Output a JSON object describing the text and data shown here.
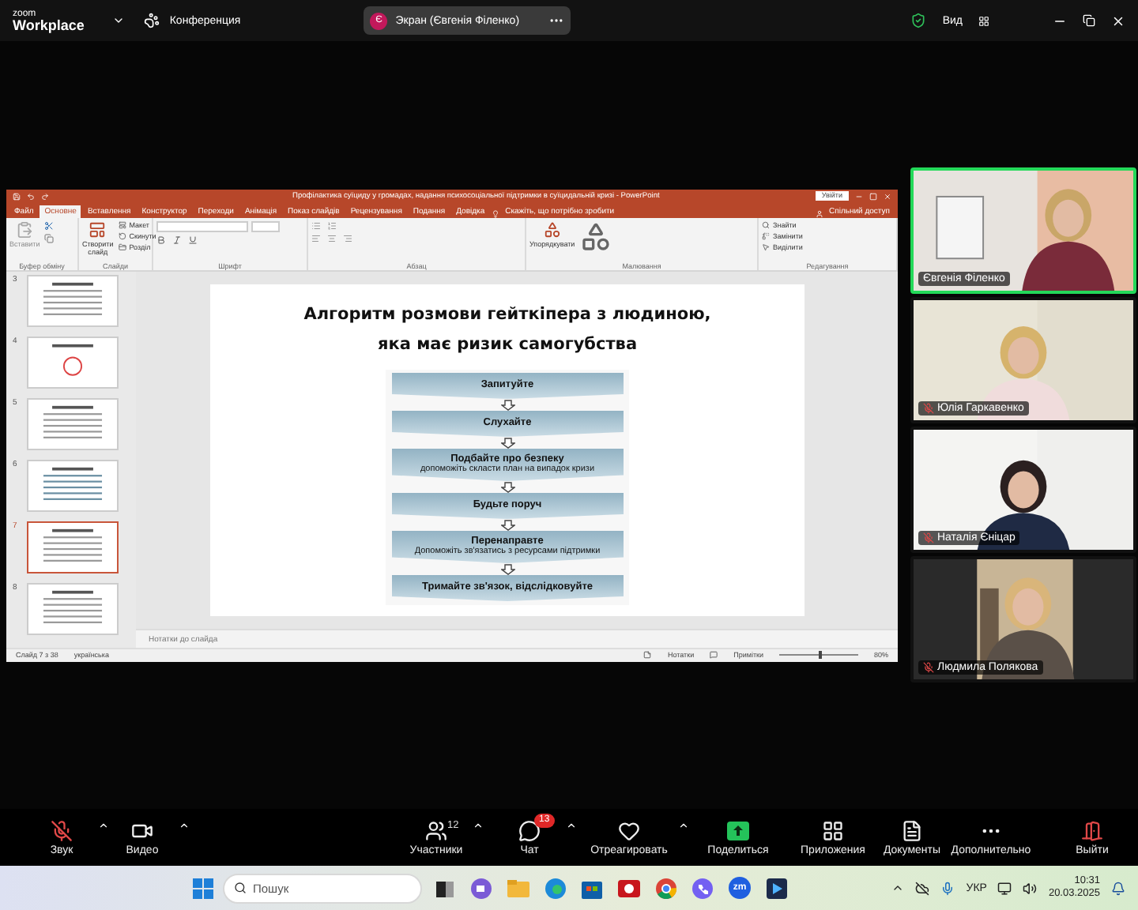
{
  "zoom_bar": {
    "logo_top": "zoom",
    "logo_bottom": "Workplace",
    "meeting_label": "Конференция",
    "screen_share": {
      "avatar": "Є",
      "title": "Экран (Євгенія Філенко)"
    },
    "view_label": "Вид"
  },
  "powerpoint": {
    "title": "Профілактика суїциду у громадах, надання психосоціальної підтримки в суїцидальній кризі  -  PowerPoint",
    "sign_in": "Увійти",
    "tabs": [
      {
        "label": "Файл",
        "selected": false
      },
      {
        "label": "Основне",
        "selected": true
      },
      {
        "label": "Вставлення",
        "selected": false
      },
      {
        "label": "Конструктор",
        "selected": false
      },
      {
        "label": "Переходи",
        "selected": false
      },
      {
        "label": "Анімація",
        "selected": false
      },
      {
        "label": "Показ слайдів",
        "selected": false
      },
      {
        "label": "Рецензування",
        "selected": false
      },
      {
        "label": "Подання",
        "selected": false
      },
      {
        "label": "Довідка",
        "selected": false
      }
    ],
    "tell_me": "Скажіть, що потрібно зробити",
    "share": "Спільний доступ",
    "ribbon": [
      {
        "kind": "clipboard",
        "label": "Буфер обміну",
        "buttons": [
          {
            "label": "Вставити",
            "kind": "large",
            "disabled": true
          }
        ]
      },
      {
        "kind": "slides",
        "label": "Слайди",
        "buttons": [
          {
            "label": "Створити слайд",
            "kind": "large",
            "disabled": false
          },
          {
            "label": "Макет",
            "kind": "small",
            "disabled": false
          },
          {
            "label": "Скинути",
            "kind": "small",
            "disabled": false
          },
          {
            "label": "Розділ",
            "kind": "small",
            "disabled": false
          }
        ]
      },
      {
        "kind": "font",
        "label": "Шрифт"
      },
      {
        "kind": "paragraph",
        "label": "Абзац"
      },
      {
        "kind": "drawing",
        "label": "Малювання",
        "buttons": [
          {
            "label": "Упорядкувати",
            "kind": "large",
            "disabled": false
          }
        ]
      },
      {
        "kind": "editing",
        "label": "Редагування",
        "buttons": [
          {
            "label": "Знайти",
            "kind": "small",
            "disabled": false
          },
          {
            "label": "Замінити",
            "kind": "small",
            "disabled": false
          },
          {
            "label": "Виділити",
            "kind": "small",
            "disabled": false
          }
        ]
      }
    ],
    "thumbnails": [
      {
        "number": "3",
        "selected": false
      },
      {
        "number": "4",
        "selected": false
      },
      {
        "number": "5",
        "selected": false
      },
      {
        "number": "6",
        "selected": false
      },
      {
        "number": "7",
        "selected": true
      },
      {
        "number": "8",
        "selected": false
      }
    ],
    "slide": {
      "title_lines": [
        "Алгоритм розмови гейткіпера з людиною,",
        "яка має ризик самогубства"
      ],
      "steps": [
        {
          "title": "Запитуйте"
        },
        {
          "title": "Слухайте"
        },
        {
          "title": "Подбайте про безпеку",
          "subtitle": "допоможіть скласти план на випадок кризи"
        },
        {
          "title": "Будьте поруч"
        },
        {
          "title": "Перенаправте",
          "subtitle": "Допоможіть зв'язатись з ресурсами підтримки"
        },
        {
          "title": "Тримайте зв'язок, відслідковуйте"
        }
      ]
    },
    "notes": {
      "placeholder": "Нотатки до слайда"
    },
    "status": {
      "slide_counter": "Слайд 7 з 38",
      "language": "українська",
      "notes": "Нотатки",
      "comments": "Примітки",
      "zoom": "80%",
      "zoom_slider": {
        "level": 0.5
      }
    }
  },
  "participants": [
    {
      "name": "Євгенія Філенко",
      "muted": false,
      "speaking": true
    },
    {
      "name": "Юлія Гаркавенко",
      "muted": true,
      "speaking": false
    },
    {
      "name": "Наталія Єніцар",
      "muted": true,
      "speaking": false
    },
    {
      "name": "Людмила Полякова",
      "muted": true,
      "speaking": false
    }
  ],
  "toolbar": [
    {
      "kind": "audio",
      "label": "Звук",
      "muted": true,
      "caret": true
    },
    {
      "kind": "video",
      "label": "Видео",
      "caret": true
    },
    {
      "kind": "participants",
      "label": "Участники",
      "count": "12",
      "caret": true
    },
    {
      "kind": "chat",
      "label": "Чат",
      "badge": "13",
      "caret": true
    },
    {
      "kind": "react",
      "label": "Отреагировать",
      "caret": true
    },
    {
      "kind": "share",
      "label": "Поделиться",
      "caret": false
    },
    {
      "kind": "apps",
      "label": "Приложения",
      "caret": false
    },
    {
      "kind": "docs",
      "label": "Документы",
      "caret": false
    },
    {
      "kind": "more",
      "label": "Дополнительно",
      "caret": false
    },
    {
      "kind": "leave",
      "label": "Выйти",
      "caret": false
    }
  ],
  "taskbar": {
    "search_placeholder": "Пошук",
    "zoom_icon_text": "zm",
    "language": "УКР",
    "time": "10:31",
    "date": "20.03.2025"
  }
}
